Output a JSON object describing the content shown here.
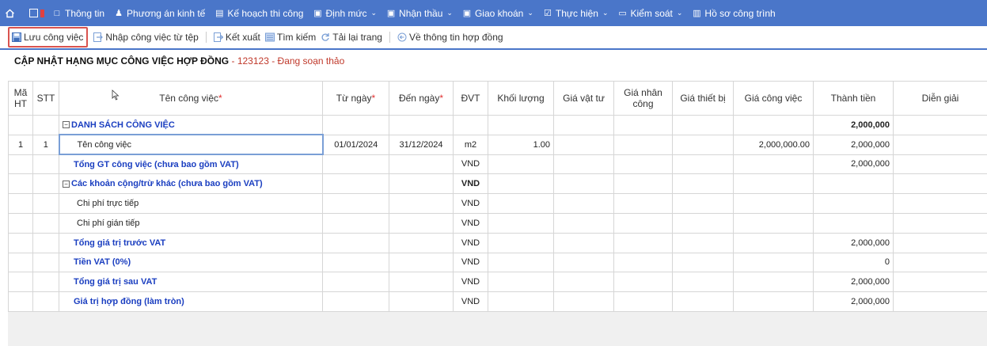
{
  "nav": {
    "items": [
      {
        "label": "Thông tin",
        "icon": "square-icon",
        "chev": ""
      },
      {
        "label": "Phương án kinh tế",
        "icon": "person-icon",
        "chev": ""
      },
      {
        "label": "Kế hoạch thi công",
        "icon": "calendar-icon",
        "chev": ""
      },
      {
        "label": "Định mức",
        "icon": "document-icon",
        "chev": "⌄"
      },
      {
        "label": "Nhận thầu",
        "icon": "document-icon",
        "chev": "⌄"
      },
      {
        "label": "Giao khoán",
        "icon": "document-icon",
        "chev": "⌄"
      },
      {
        "label": "Thực hiện",
        "icon": "checkbox-icon",
        "chev": "⌄"
      },
      {
        "label": "Kiểm soát",
        "icon": "monitor-icon",
        "chev": "⌄"
      },
      {
        "label": "Hồ sơ công trình",
        "icon": "folder-icon",
        "chev": ""
      }
    ]
  },
  "toolbar": {
    "save": "Lưu công việc",
    "import": "Nhập công việc từ tệp",
    "export": "Kết xuất",
    "search": "Tìm kiếm",
    "reload": "Tải lại trang",
    "back": "Về thông tin hợp đồng"
  },
  "title": {
    "main": "CẬP NHẬT HẠNG MỤC CÔNG VIỆC HỢP ĐỒNG",
    "sub": " - 123123 - Đang soạn thảo"
  },
  "table": {
    "headers": {
      "ma_ht": "Mã HT",
      "stt": "STT",
      "ten": "Tên công việc",
      "tu_ngay": "Từ ngày",
      "den_ngay": "Đến ngày",
      "dvt": "ĐVT",
      "khoi_luong": "Khối lượng",
      "gia_vat_tu": "Giá vật tư",
      "gia_nhan_cong": "Giá nhân công",
      "gia_thiet_bi": "Giá thiết bị",
      "gia_cong_viec": "Giá công việc",
      "thanh_tien": "Thành tiền",
      "dien_giai": "Diễn giải",
      "required_mark": "*"
    },
    "rows": [
      {
        "ma_ht": "",
        "stt": "",
        "ten": "DANH SÁCH CÔNG VIỆC",
        "tu_ngay": "",
        "den_ngay": "",
        "dvt": "",
        "khoi_luong": "",
        "gia_cong_viec": "",
        "thanh_tien": "2,000,000"
      },
      {
        "ma_ht": "1",
        "stt": "1",
        "ten": "Tên công việc",
        "tu_ngay": "01/01/2024",
        "den_ngay": "31/12/2024",
        "dvt": "m2",
        "khoi_luong": "1.00",
        "gia_cong_viec": "2,000,000.00",
        "thanh_tien": "2,000,000"
      },
      {
        "ma_ht": "",
        "stt": "",
        "ten": "Tổng GT công việc (chưa bao gồm VAT)",
        "tu_ngay": "",
        "den_ngay": "",
        "dvt": "VND",
        "khoi_luong": "",
        "gia_cong_viec": "",
        "thanh_tien": "2,000,000"
      },
      {
        "ma_ht": "",
        "stt": "",
        "ten": "Các khoản cộng/trừ khác (chưa bao gồm VAT)",
        "tu_ngay": "",
        "den_ngay": "",
        "dvt": "VND",
        "khoi_luong": "",
        "gia_cong_viec": "",
        "thanh_tien": ""
      },
      {
        "ma_ht": "",
        "stt": "",
        "ten": "Chi phí trực tiếp",
        "tu_ngay": "",
        "den_ngay": "",
        "dvt": "VND",
        "khoi_luong": "",
        "gia_cong_viec": "",
        "thanh_tien": ""
      },
      {
        "ma_ht": "",
        "stt": "",
        "ten": "Chi phí gián tiếp",
        "tu_ngay": "",
        "den_ngay": "",
        "dvt": "VND",
        "khoi_luong": "",
        "gia_cong_viec": "",
        "thanh_tien": ""
      },
      {
        "ma_ht": "",
        "stt": "",
        "ten": "Tổng giá trị trước VAT",
        "tu_ngay": "",
        "den_ngay": "",
        "dvt": "VND",
        "khoi_luong": "",
        "gia_cong_viec": "",
        "thanh_tien": "2,000,000"
      },
      {
        "ma_ht": "",
        "stt": "",
        "ten": "Tiền VAT (0%)",
        "tu_ngay": "",
        "den_ngay": "",
        "dvt": "VND",
        "khoi_luong": "",
        "gia_cong_viec": "",
        "thanh_tien": "0"
      },
      {
        "ma_ht": "",
        "stt": "",
        "ten": "Tổng giá trị sau VAT",
        "tu_ngay": "",
        "den_ngay": "",
        "dvt": "VND",
        "khoi_luong": "",
        "gia_cong_viec": "",
        "thanh_tien": "2,000,000"
      },
      {
        "ma_ht": "",
        "stt": "",
        "ten": "Giá trị hợp đồng (làm tròn)",
        "tu_ngay": "",
        "den_ngay": "",
        "dvt": "VND",
        "khoi_luong": "",
        "gia_cong_viec": "",
        "thanh_tien": "2,000,000"
      }
    ]
  },
  "colors": {
    "nav_bg": "#4a76c9",
    "link_blue": "#1a3ec0",
    "status_red": "#c0392b",
    "highlight_red": "#d9534f"
  }
}
